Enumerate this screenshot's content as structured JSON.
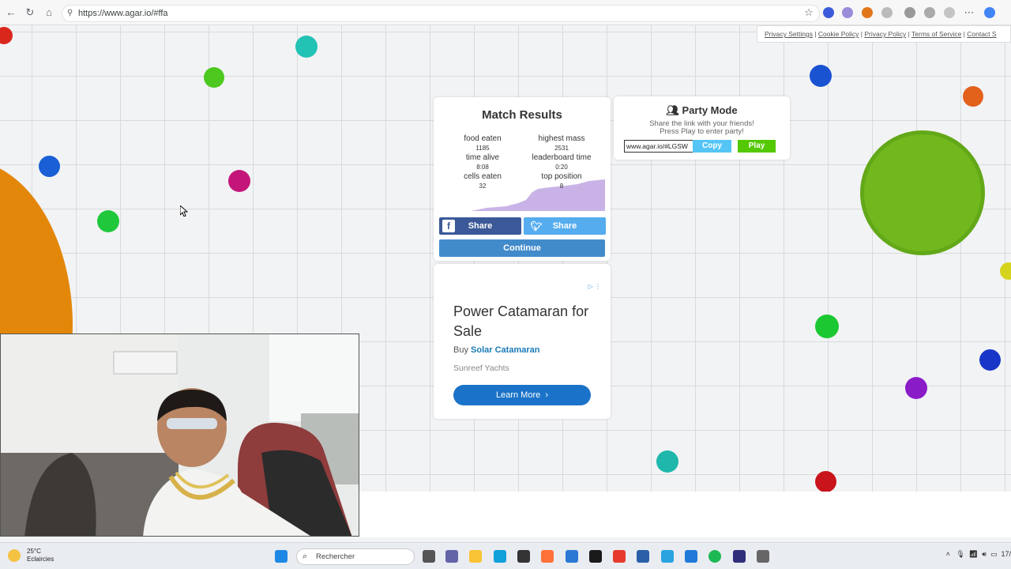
{
  "browser": {
    "url": "https://www.agar.io/#ffa"
  },
  "legal_links": [
    "Privacy Settings",
    "Cookie Policy",
    "Privacy Policy",
    "Terms of Service",
    "Contact S"
  ],
  "match_results": {
    "title": "Match Results",
    "stats": [
      {
        "label": "food eaten",
        "value": "1185"
      },
      {
        "label": "highest mass",
        "value": "2531"
      },
      {
        "label": "time alive",
        "value": "8:08"
      },
      {
        "label": "leaderboard time",
        "value": "0:20"
      },
      {
        "label": "cells eaten",
        "value": "32"
      },
      {
        "label": "top position",
        "value": "8"
      }
    ],
    "facebook_share_label": "Share",
    "twitter_share_label": "Share",
    "continue_label": "Continue"
  },
  "party_mode": {
    "title": "Party Mode",
    "subtitle_line1": "Share the link with your friends!",
    "subtitle_line2": "Press Play to enter party!",
    "link_value": "www.agar.io/#LGSW",
    "copy_label": "Copy",
    "play_label": "Play"
  },
  "ad": {
    "headline": "Power Catamaran for Sale",
    "buy_prefix": "Buy",
    "buy_link": "Solar Catamaran",
    "advertiser": "Sunreef Yachts",
    "cta_label": "Learn More"
  },
  "taskbar": {
    "weather_temp": "25°C",
    "weather_desc": "Eclaircies",
    "search_placeholder": "Rechercher",
    "clock_partial": "17/"
  },
  "colors": {
    "facebook": "#3b5998",
    "twitter": "#55acee",
    "continue": "#428bca",
    "copy": "#54c5f5",
    "play": "#54c800"
  }
}
